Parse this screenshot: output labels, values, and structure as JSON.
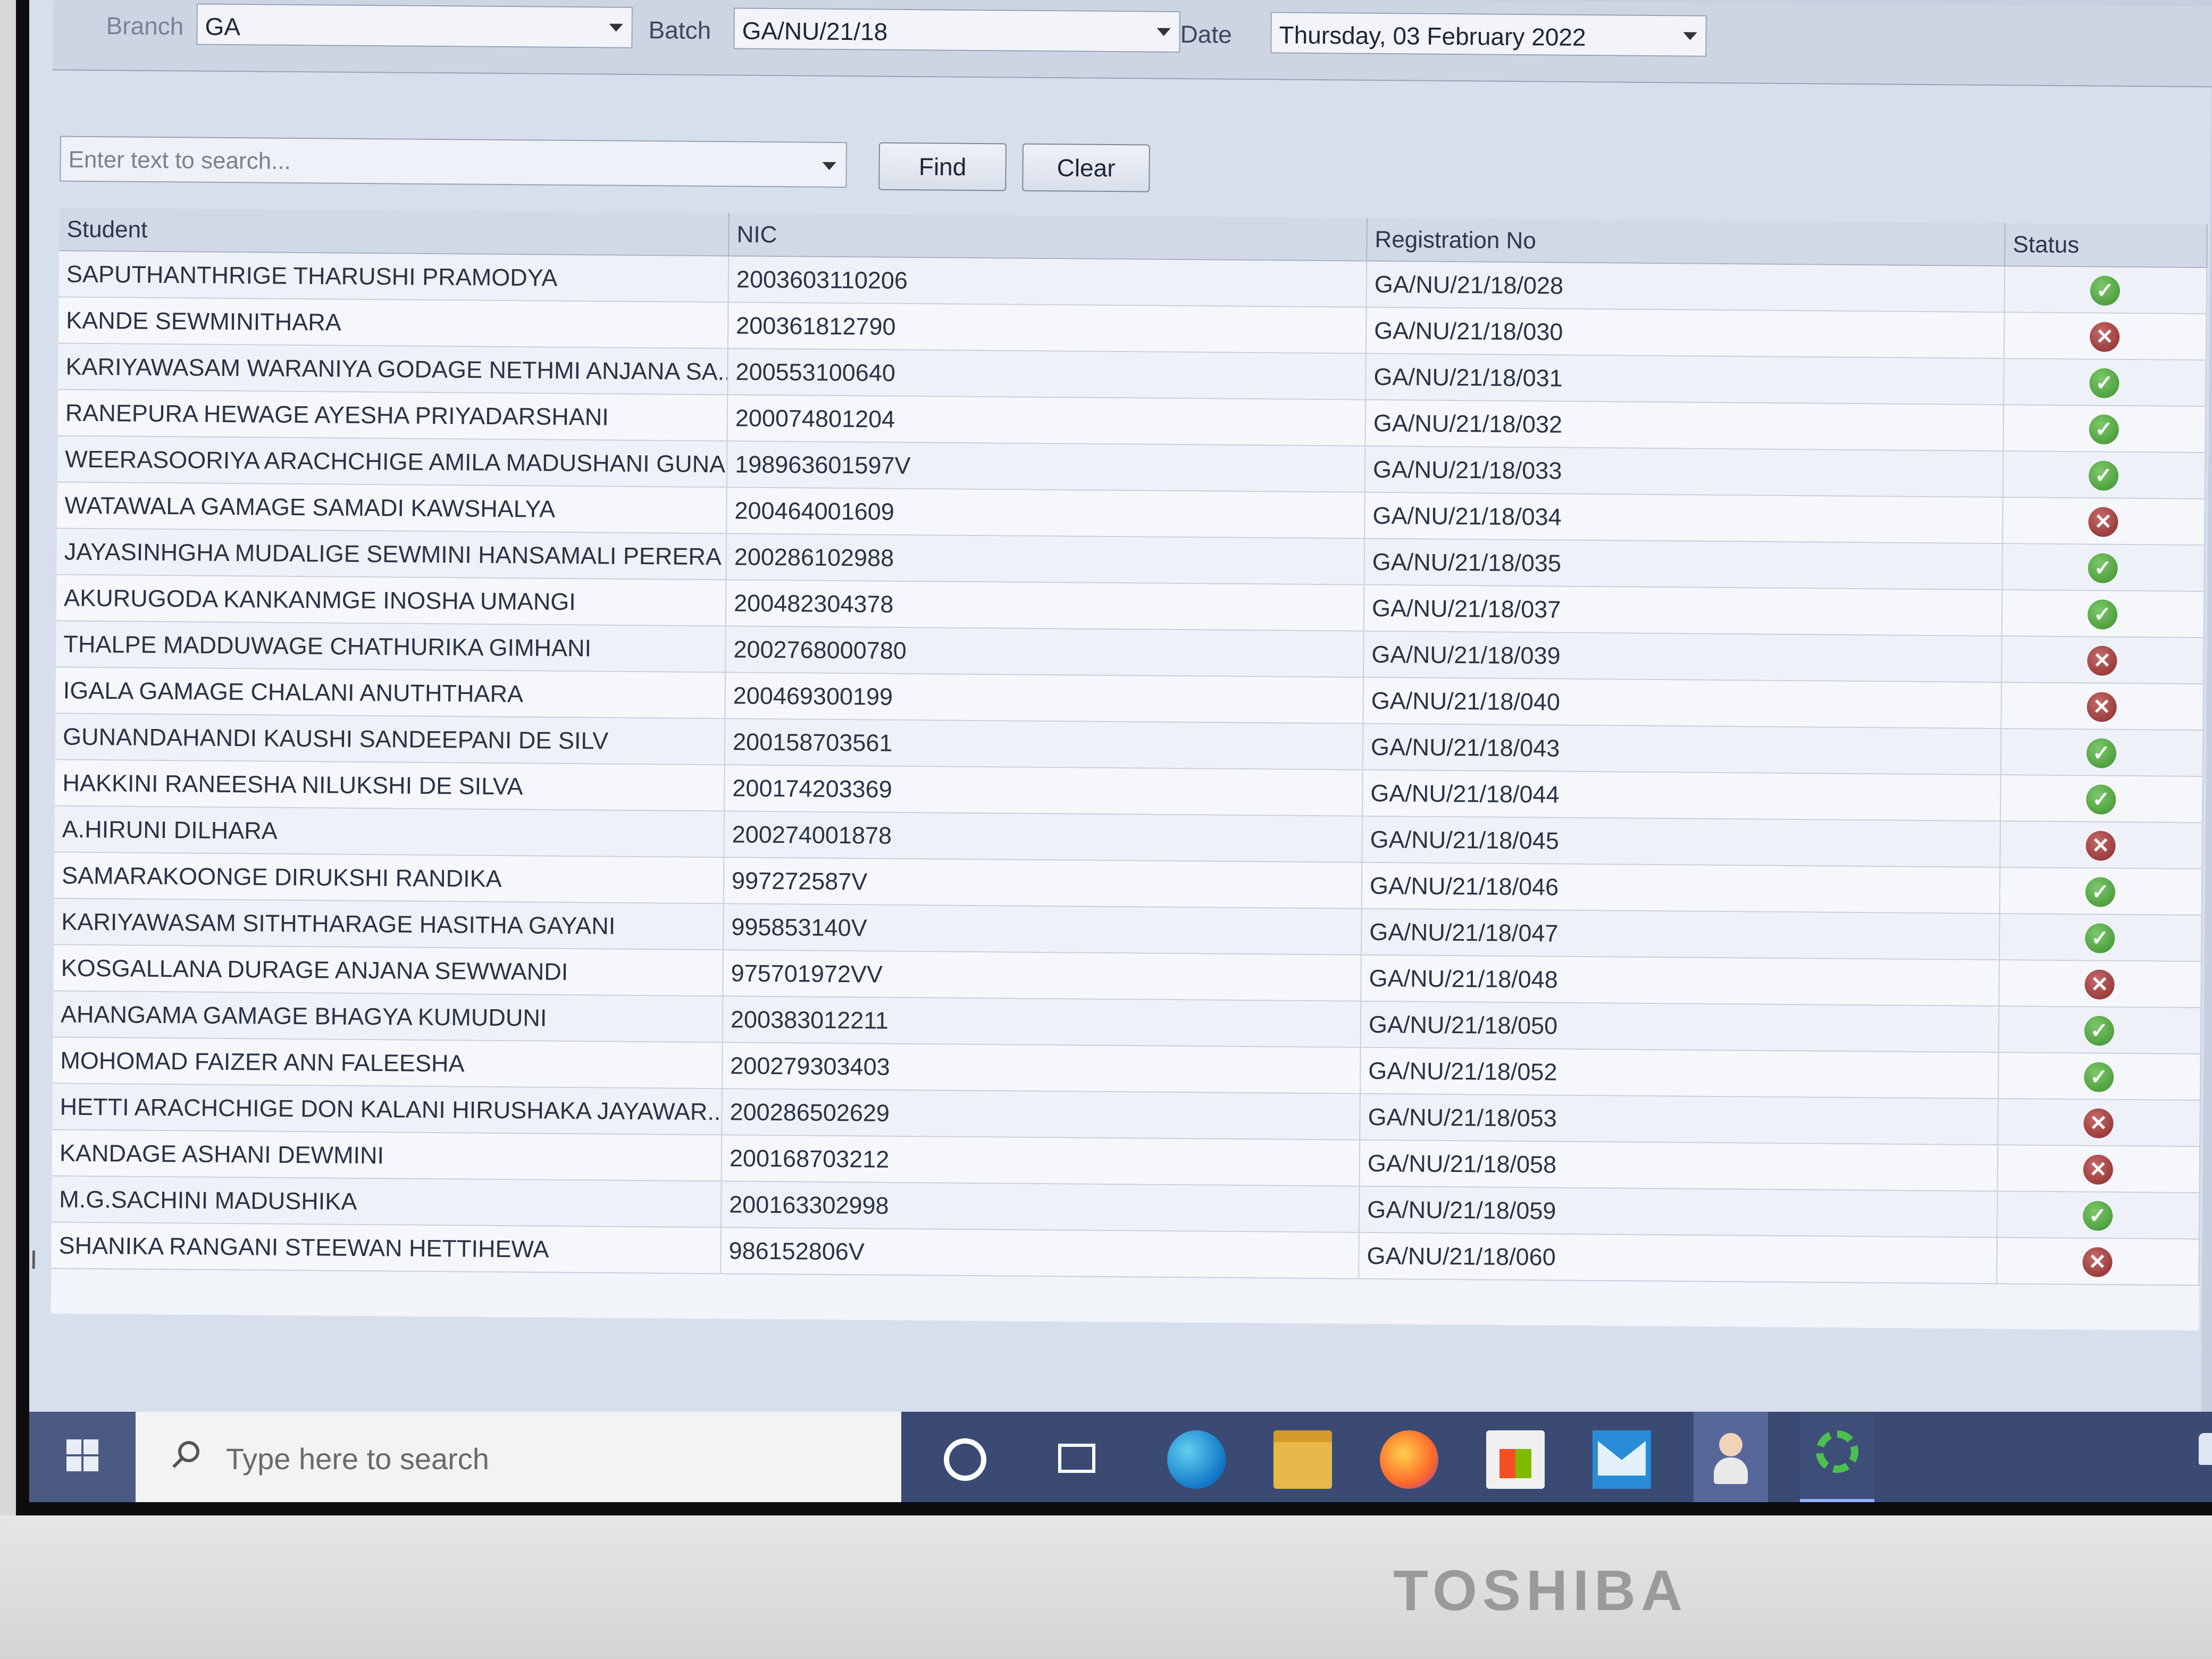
{
  "filters": {
    "branch_label": "Branch",
    "branch_value": "GA",
    "batch_label": "Batch",
    "batch_value": "GA/NU/21/18",
    "date_label": "Date",
    "date_value": "Thursday, 03 February 2022"
  },
  "search": {
    "placeholder": "Enter text to search...",
    "find_label": "Find",
    "clear_label": "Clear"
  },
  "table": {
    "columns": [
      "Student",
      "NIC",
      "Registration No",
      "Status"
    ],
    "rows": [
      {
        "student": "SAPUTHANTHRIGE THARUSHI PRAMODYA",
        "nic": "2003603110206",
        "reg": "GA/NU/21/18/028",
        "status": "present"
      },
      {
        "student": "KANDE SEWMINITHARA",
        "nic": "200361812790",
        "reg": "GA/NU/21/18/030",
        "status": "absent"
      },
      {
        "student": "KARIYAWASAM WARANIYA GODAGE NETHMI ANJANA SA...",
        "nic": "200553100640",
        "reg": "GA/NU/21/18/031",
        "status": "present"
      },
      {
        "student": "RANEPURA HEWAGE AYESHA PRIYADARSHANI",
        "nic": "200074801204",
        "reg": "GA/NU/21/18/032",
        "status": "present"
      },
      {
        "student": "WEERASOORIYA ARACHCHIGE AMILA MADUSHANI GUNA...",
        "nic": "198963601597V",
        "reg": "GA/NU/21/18/033",
        "status": "present"
      },
      {
        "student": "WATAWALA GAMAGE SAMADI KAWSHALYA",
        "nic": "200464001609",
        "reg": "GA/NU/21/18/034",
        "status": "absent"
      },
      {
        "student": "JAYASINHGHA MUDALIGE SEWMINI HANSAMALI PERERA",
        "nic": "200286102988",
        "reg": "GA/NU/21/18/035",
        "status": "present"
      },
      {
        "student": "AKURUGODA KANKANMGE INOSHA UMANGI",
        "nic": "200482304378",
        "reg": "GA/NU/21/18/037",
        "status": "present"
      },
      {
        "student": "THALPE MADDUWAGE CHATHURIKA GIMHANI",
        "nic": "2002768000780",
        "reg": "GA/NU/21/18/039",
        "status": "absent"
      },
      {
        "student": "IGALA GAMAGE CHALANI ANUTHTHARA",
        "nic": "200469300199",
        "reg": "GA/NU/21/18/040",
        "status": "absent"
      },
      {
        "student": "GUNANDAHANDI KAUSHI SANDEEPANI DE SILV",
        "nic": "200158703561",
        "reg": "GA/NU/21/18/043",
        "status": "present"
      },
      {
        "student": "HAKKINI RANEESHA NILUKSHI DE SILVA",
        "nic": "200174203369",
        "reg": "GA/NU/21/18/044",
        "status": "present"
      },
      {
        "student": "A.HIRUNI DILHARA",
        "nic": "200274001878",
        "reg": "GA/NU/21/18/045",
        "status": "absent"
      },
      {
        "student": "SAMARAKOONGE DIRUKSHI RANDIKA",
        "nic": "997272587V",
        "reg": "GA/NU/21/18/046",
        "status": "present"
      },
      {
        "student": "KARIYAWASAM SITHTHARAGE HASITHA GAYANI",
        "nic": "995853140V",
        "reg": "GA/NU/21/18/047",
        "status": "present"
      },
      {
        "student": "KOSGALLANA DURAGE ANJANA SEWWANDI",
        "nic": "975701972VV",
        "reg": "GA/NU/21/18/048",
        "status": "absent"
      },
      {
        "student": "AHANGAMA GAMAGE BHAGYA KUMUDUNI",
        "nic": "200383012211",
        "reg": "GA/NU/21/18/050",
        "status": "present"
      },
      {
        "student": "MOHOMAD FAIZER ANN FALEESHA",
        "nic": "200279303403",
        "reg": "GA/NU/21/18/052",
        "status": "present"
      },
      {
        "student": "HETTI ARACHCHIGE DON KALANI HIRUSHAKA JAYAWAR...",
        "nic": "200286502629",
        "reg": "GA/NU/21/18/053",
        "status": "absent"
      },
      {
        "student": "KANDAGE ASHANI DEWMINI",
        "nic": "200168703212",
        "reg": "GA/NU/21/18/058",
        "status": "absent"
      },
      {
        "student": "M.G.SACHINI  MADUSHIKA",
        "nic": "200163302998",
        "reg": "GA/NU/21/18/059",
        "status": "present"
      },
      {
        "student": "SHANIKA RANGANI STEEWAN HETTIHEWA",
        "nic": "986152806V",
        "reg": "GA/NU/21/18/060",
        "status": "absent"
      }
    ]
  },
  "taskbar": {
    "search_placeholder": "Type here to search",
    "icons": [
      "windows-start-icon",
      "search-icon",
      "cortana-icon",
      "task-view-icon",
      "edge-icon",
      "file-explorer-icon",
      "firefox-icon",
      "store-icon",
      "mail-icon",
      "user-app-icon",
      "green-app-icon"
    ]
  },
  "device": {
    "brand": "TOSHIBA"
  },
  "colors": {
    "present": "#3e8f2e",
    "absent": "#8a2a2a",
    "taskbar": "#3a4a73"
  }
}
